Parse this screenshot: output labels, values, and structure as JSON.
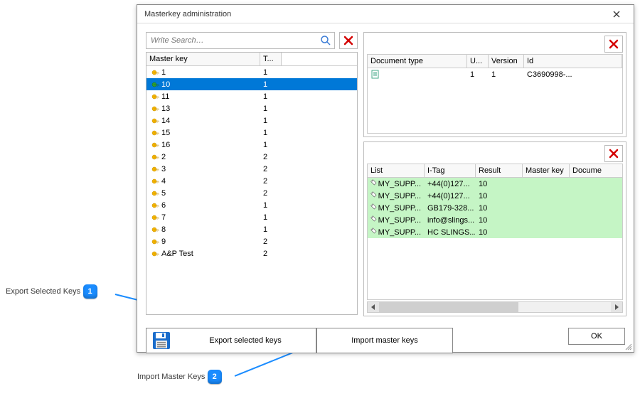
{
  "window": {
    "title": "Masterkey administration"
  },
  "search": {
    "placeholder": "Write Search…"
  },
  "left_grid": {
    "headers": {
      "col1": "Master key",
      "col2": "T..."
    },
    "rows": [
      {
        "icon": "yellow",
        "key": "1",
        "t": "1",
        "selected": false
      },
      {
        "icon": "green",
        "key": "10",
        "t": "1",
        "selected": true
      },
      {
        "icon": "yellow",
        "key": "11",
        "t": "1",
        "selected": false
      },
      {
        "icon": "yellow",
        "key": "13",
        "t": "1",
        "selected": false
      },
      {
        "icon": "yellow",
        "key": "14",
        "t": "1",
        "selected": false
      },
      {
        "icon": "yellow",
        "key": "15",
        "t": "1",
        "selected": false
      },
      {
        "icon": "yellow",
        "key": "16",
        "t": "1",
        "selected": false
      },
      {
        "icon": "yellow",
        "key": "2",
        "t": "2",
        "selected": false
      },
      {
        "icon": "yellow",
        "key": "3",
        "t": "2",
        "selected": false
      },
      {
        "icon": "yellow",
        "key": "4",
        "t": "2",
        "selected": false
      },
      {
        "icon": "yellow",
        "key": "5",
        "t": "2",
        "selected": false
      },
      {
        "icon": "yellow",
        "key": "6",
        "t": "1",
        "selected": false
      },
      {
        "icon": "yellow",
        "key": "7",
        "t": "1",
        "selected": false
      },
      {
        "icon": "yellow",
        "key": "8",
        "t": "1",
        "selected": false
      },
      {
        "icon": "yellow",
        "key": "9",
        "t": "2",
        "selected": false
      },
      {
        "icon": "yellow",
        "key": "A&P Test",
        "t": "2",
        "selected": false
      }
    ]
  },
  "top_right_grid": {
    "headers": {
      "c1": "Document type",
      "c2": "U...",
      "c3": "Version",
      "c4": "Id"
    },
    "rows": [
      {
        "doctype": "",
        "u": "1",
        "version": "1",
        "id": "C3690998-..."
      }
    ]
  },
  "bot_right_grid": {
    "headers": {
      "c1": "List",
      "c2": "I-Tag",
      "c3": "Result",
      "c4": "Master key",
      "c5": "Docume"
    },
    "rows": [
      {
        "list": "MY_SUPP...",
        "itag": "+44(0)127...",
        "result": "10",
        "mk": "",
        "doc": ""
      },
      {
        "list": "MY_SUPP...",
        "itag": "+44(0)127...",
        "result": "10",
        "mk": "",
        "doc": ""
      },
      {
        "list": "MY_SUPP...",
        "itag": "GB179-328...",
        "result": "10",
        "mk": "",
        "doc": ""
      },
      {
        "list": "MY_SUPP...",
        "itag": "info@slings...",
        "result": "10",
        "mk": "",
        "doc": ""
      },
      {
        "list": "MY_SUPP...",
        "itag": "HC SLINGS...",
        "result": "10",
        "mk": "",
        "doc": ""
      }
    ]
  },
  "buttons": {
    "export": "Export selected keys",
    "import": "Import master keys",
    "ok": "OK"
  },
  "callouts": {
    "c1": {
      "label": "Export Selected Keys",
      "num": "1"
    },
    "c2": {
      "label": "Import Master Keys",
      "num": "2"
    }
  }
}
